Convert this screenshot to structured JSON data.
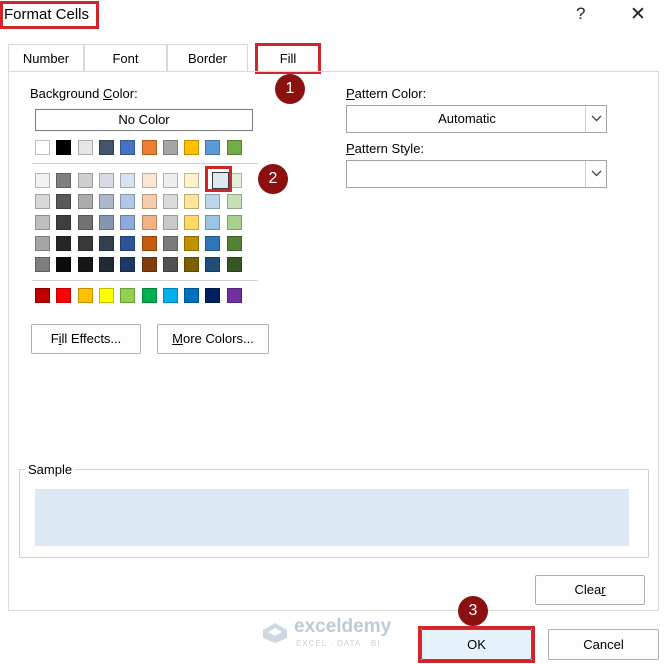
{
  "dialog": {
    "title": "Format Cells",
    "help": "?",
    "close": "✕"
  },
  "tabs": [
    {
      "label": "Number"
    },
    {
      "label": "Font"
    },
    {
      "label": "Border"
    },
    {
      "label": "Fill",
      "active": true
    }
  ],
  "fill": {
    "background_color_label_pre": "Background ",
    "background_color_label_key": "C",
    "background_color_label_post": "olor:",
    "no_color": "No Color",
    "fill_effects_key": "i",
    "fill_effects_pre": "F",
    "fill_effects_post": "ll Effects...",
    "more_colors_key": "M",
    "more_colors_post": "ore Colors...",
    "pattern_color_label_key": "P",
    "pattern_color_label_post": "attern Color:",
    "pattern_color_value": "Automatic",
    "pattern_style_label_key": "P",
    "pattern_style_label_post": "attern Style:",
    "pattern_style_value": "",
    "sample_label": "Sample",
    "sample_color": "#dce8f4",
    "selected_swatch": "row 2, column 9"
  },
  "palette": {
    "theme_top": [
      "#ffffff",
      "#000000",
      "#e7e6e6",
      "#44546a",
      "#4472c4",
      "#ed7d31",
      "#a5a5a5",
      "#ffc000",
      "#5b9bd5",
      "#70ad47"
    ],
    "theme_shades": [
      [
        "#f2f2f2",
        "#7f7f7f",
        "#d0cece",
        "#d6dce4",
        "#d9e2f3",
        "#fbe5d5",
        "#ededed",
        "#fff2cc",
        "#dce8f4",
        "#e2efd9"
      ],
      [
        "#d8d8d8",
        "#595959",
        "#aeabab",
        "#adb9ca",
        "#b4c6e7",
        "#f7cbac",
        "#dbdbdb",
        "#fee599",
        "#bdd6ee",
        "#c5e0b3"
      ],
      [
        "#bfbfbf",
        "#3f3f3f",
        "#757171",
        "#8496b0",
        "#8eaadb",
        "#f4b183",
        "#c9c9c9",
        "#ffd965",
        "#9cc3e5",
        "#a8d08d"
      ],
      [
        "#a5a5a5",
        "#262626",
        "#3a3838",
        "#323f4f",
        "#2f5496",
        "#c55a11",
        "#7b7b7b",
        "#bf9000",
        "#2e75b5",
        "#538135"
      ],
      [
        "#7f7f7f",
        "#0c0c0c",
        "#171616",
        "#222a35",
        "#1f3864",
        "#833c0b",
        "#525252",
        "#7f6000",
        "#1f4e79",
        "#375623"
      ]
    ],
    "standard": [
      "#c00000",
      "#ff0000",
      "#ffc000",
      "#ffff00",
      "#92d050",
      "#00b050",
      "#00b0f0",
      "#0070c0",
      "#002060",
      "#7030a0"
    ]
  },
  "footer": {
    "clear_key": "r",
    "clear_pre": "Clea",
    "ok": "OK",
    "cancel": "Cancel"
  },
  "annotations": {
    "step1": "1",
    "step2": "2",
    "step3": "3",
    "highlight_color": "#d0252a",
    "badge_color": "#8b1010"
  },
  "watermark": {
    "name": "exceldemy",
    "tagline": "EXCEL · DATA · BI"
  }
}
